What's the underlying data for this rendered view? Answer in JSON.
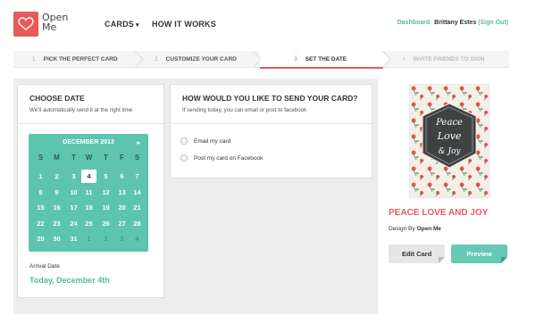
{
  "header": {
    "logo_text": "Open Me",
    "nav": {
      "cards": "CARDS",
      "how": "HOW IT WORKS"
    },
    "user": {
      "dashboard": "Dashboard",
      "name": "Brittany Estes",
      "signout": "(Sign Out)"
    }
  },
  "steps": [
    {
      "num": "1",
      "label": "PICK THE PERFECT CARD"
    },
    {
      "num": "2",
      "label": "CUSTOMIZE YOUR CARD"
    },
    {
      "num": "3",
      "label": "SET THE DATE"
    },
    {
      "num": "4",
      "label": "INVITE FRIENDS TO SIGN"
    }
  ],
  "choose_date": {
    "title": "CHOOSE DATE",
    "subtitle": "We'll automatically send it at the right time"
  },
  "calendar": {
    "month": "DECEMBER 2013",
    "next": "▸",
    "dow": [
      "S",
      "M",
      "T",
      "W",
      "T",
      "F",
      "S"
    ],
    "days": [
      [
        "1",
        "2",
        "3",
        "4",
        "5",
        "6",
        "7"
      ],
      [
        "8",
        "9",
        "10",
        "11",
        "12",
        "13",
        "14"
      ],
      [
        "15",
        "16",
        "17",
        "18",
        "19",
        "20",
        "21"
      ],
      [
        "22",
        "23",
        "24",
        "25",
        "26",
        "27",
        "28"
      ],
      [
        "29",
        "30",
        "31",
        "1",
        "2",
        "3",
        "4"
      ]
    ]
  },
  "arrival": {
    "label": "Arrival Date",
    "date": "Today, December 4th"
  },
  "send": {
    "title": "HOW WOULD YOU LIKE TO SEND YOUR CARD?",
    "subtitle": "If sending today, you can email or post to facebook",
    "options": [
      "Email my card",
      "Post my card on Facebook"
    ]
  },
  "card": {
    "title": "PEACE LOVE AND JOY",
    "design_by_label": "Design By",
    "design_by_name": "Open Me",
    "art_text": [
      "Peace",
      "Love",
      "& Joy"
    ],
    "edit_label": "Edit Card",
    "preview_label": "Preview"
  },
  "colors": {
    "brand_red": "#e85a5a",
    "teal": "#5dc4ad"
  }
}
